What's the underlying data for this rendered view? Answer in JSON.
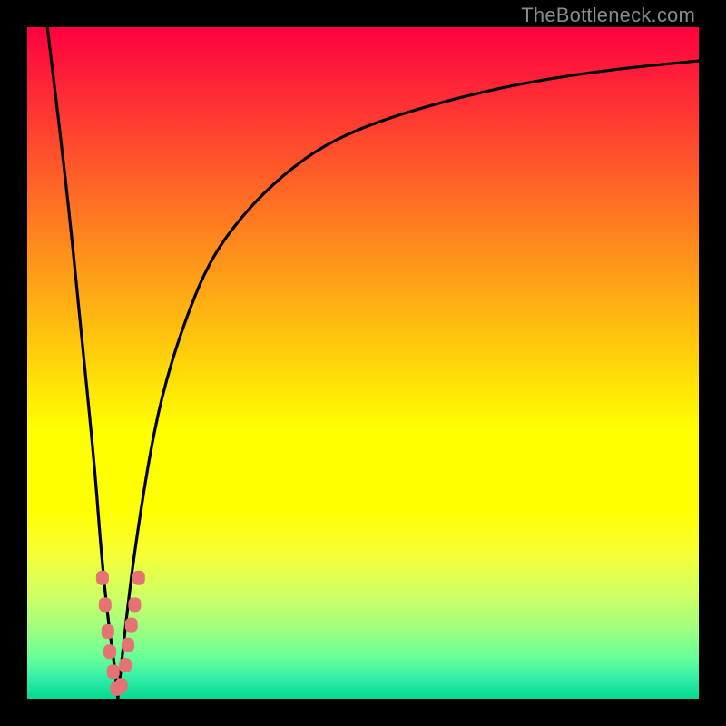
{
  "watermark": "TheBottleneck.com",
  "chart_data": {
    "type": "line",
    "title": "",
    "xlabel": "",
    "ylabel": "",
    "xlim": [
      0,
      100
    ],
    "ylim": [
      0,
      100
    ],
    "grid": false,
    "legend": false,
    "series": [
      {
        "name": "left-branch",
        "x": [
          3,
          6,
          8,
          10,
          11,
          12,
          13,
          13.5
        ],
        "values": [
          100,
          75,
          55,
          35,
          22,
          12,
          5,
          0
        ]
      },
      {
        "name": "right-branch",
        "x": [
          13.5,
          14,
          15,
          16,
          18,
          20,
          23,
          27,
          32,
          38,
          45,
          55,
          70,
          85,
          100
        ],
        "values": [
          0,
          5,
          14,
          22,
          35,
          45,
          55,
          65,
          72,
          78,
          83,
          87,
          91,
          93.5,
          95
        ]
      }
    ],
    "markers": [
      {
        "x": 11.2,
        "y": 18
      },
      {
        "x": 11.6,
        "y": 14
      },
      {
        "x": 12.0,
        "y": 10
      },
      {
        "x": 12.3,
        "y": 7
      },
      {
        "x": 12.8,
        "y": 4
      },
      {
        "x": 13.3,
        "y": 1.5
      },
      {
        "x": 14.0,
        "y": 2
      },
      {
        "x": 14.6,
        "y": 5
      },
      {
        "x": 15.0,
        "y": 8
      },
      {
        "x": 15.5,
        "y": 11
      },
      {
        "x": 16.0,
        "y": 14
      },
      {
        "x": 16.6,
        "y": 18
      }
    ]
  }
}
